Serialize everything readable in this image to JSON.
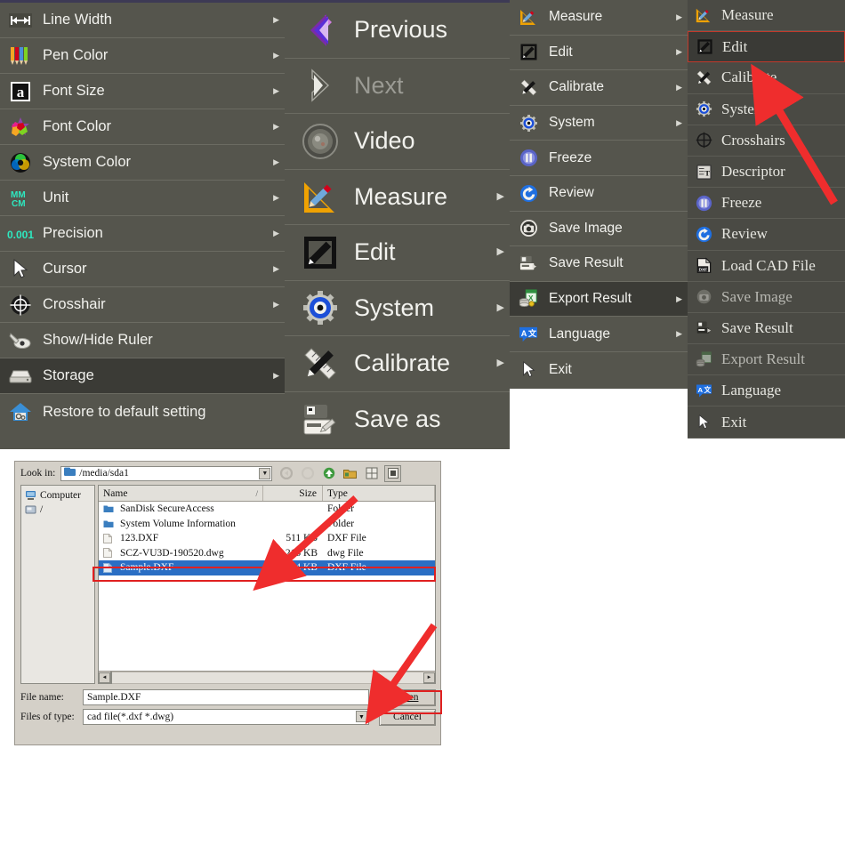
{
  "colors": {
    "menu_bg": "#55554d",
    "menu_bg_dark": "#4a4a44",
    "menu_selected": "#3b3b36",
    "menu_text": "#f2f2ee",
    "menu_text_disabled": "#9b9b94",
    "dialog_bg": "#d4d0c8",
    "selection_blue": "#2a6ec4",
    "annotation_red": "#e02020",
    "accent_purple": "#3d3a55"
  },
  "settings_menu": {
    "name": "Settings / System sub-menu",
    "items": [
      {
        "label": "Line Width",
        "icon": "line-width-icon",
        "arrow": true,
        "selected": false
      },
      {
        "label": "Pen Color",
        "icon": "pen-color-icon",
        "arrow": true,
        "selected": false
      },
      {
        "label": "Font Size",
        "icon": "font-size-icon",
        "arrow": true,
        "selected": false
      },
      {
        "label": "Font Color",
        "icon": "font-color-icon",
        "arrow": true,
        "selected": false
      },
      {
        "label": "System Color",
        "icon": "system-color-icon",
        "arrow": true,
        "selected": false
      },
      {
        "label": "Unit",
        "icon": "unit-icon",
        "arrow": true,
        "selected": false
      },
      {
        "label": "Precision",
        "icon": "precision-icon",
        "arrow": true,
        "selected": false
      },
      {
        "label": "Cursor",
        "icon": "cursor-icon",
        "arrow": true,
        "selected": false
      },
      {
        "label": "Crosshair",
        "icon": "crosshair-icon",
        "arrow": true,
        "selected": false
      },
      {
        "label": "Show/Hide Ruler",
        "icon": "ruler-toggle-icon",
        "arrow": false,
        "selected": false
      },
      {
        "label": "Storage",
        "icon": "storage-icon",
        "arrow": true,
        "selected": true
      },
      {
        "label": "Restore to default setting",
        "icon": "restore-default-icon",
        "arrow": false,
        "selected": false
      }
    ]
  },
  "main_menu": {
    "name": "Main menu (large)",
    "items": [
      {
        "label": "Previous",
        "icon": "previous-icon",
        "arrow": false,
        "disabled": false
      },
      {
        "label": "Next",
        "icon": "next-icon",
        "arrow": false,
        "disabled": true
      },
      {
        "label": "Video",
        "icon": "video-icon",
        "arrow": false,
        "disabled": false
      },
      {
        "label": "Measure",
        "icon": "measure-icon",
        "arrow": true,
        "disabled": false
      },
      {
        "label": "Edit",
        "icon": "edit-icon",
        "arrow": true,
        "disabled": false
      },
      {
        "label": "System",
        "icon": "system-icon",
        "arrow": true,
        "disabled": false
      },
      {
        "label": "Calibrate",
        "icon": "calibrate-icon",
        "arrow": true,
        "disabled": false
      },
      {
        "label": "Save as",
        "icon": "save-as-icon",
        "arrow": false,
        "disabled": false
      }
    ]
  },
  "compact_menu": {
    "name": "Compact menu",
    "items": [
      {
        "label": "Measure",
        "icon": "measure-icon",
        "arrow": true,
        "selected": false
      },
      {
        "label": "Edit",
        "icon": "edit-icon",
        "arrow": true,
        "selected": false
      },
      {
        "label": "Calibrate",
        "icon": "calibrate-icon",
        "arrow": true,
        "selected": false
      },
      {
        "label": "System",
        "icon": "system-icon",
        "arrow": true,
        "selected": false
      },
      {
        "label": "Freeze",
        "icon": "freeze-icon",
        "arrow": false,
        "selected": false
      },
      {
        "label": "Review",
        "icon": "review-icon",
        "arrow": false,
        "selected": false
      },
      {
        "label": "Save Image",
        "icon": "save-image-icon",
        "arrow": false,
        "selected": false
      },
      {
        "label": "Save Result",
        "icon": "save-result-icon",
        "arrow": false,
        "selected": false
      },
      {
        "label": "Export Result",
        "icon": "export-result-icon",
        "arrow": true,
        "selected": true
      },
      {
        "label": "Language",
        "icon": "language-icon",
        "arrow": true,
        "selected": false
      },
      {
        "label": "Exit",
        "icon": "exit-icon",
        "arrow": false,
        "selected": false
      }
    ]
  },
  "extended_menu": {
    "name": "Extended menu with Load CAD File",
    "items": [
      {
        "label": "Measure",
        "icon": "measure-icon",
        "boxed": false,
        "dim": false
      },
      {
        "label": "Edit",
        "icon": "edit-icon",
        "boxed": true,
        "dim": false
      },
      {
        "label": "Calibrate",
        "icon": "calibrate-icon",
        "boxed": false,
        "dim": false
      },
      {
        "label": "System",
        "icon": "system-icon",
        "boxed": false,
        "dim": false
      },
      {
        "label": "Crosshairs",
        "icon": "crosshair-icon",
        "boxed": false,
        "dim": false
      },
      {
        "label": "Descriptor",
        "icon": "descriptor-icon",
        "boxed": false,
        "dim": false
      },
      {
        "label": "Freeze",
        "icon": "freeze-icon",
        "boxed": false,
        "dim": false
      },
      {
        "label": "Review",
        "icon": "review-icon",
        "boxed": false,
        "dim": false
      },
      {
        "label": "Load CAD File",
        "icon": "load-cad-file-icon",
        "boxed": false,
        "dim": false
      },
      {
        "label": "Save Image",
        "icon": "save-image-icon",
        "boxed": false,
        "dim": true
      },
      {
        "label": "Save Result",
        "icon": "save-result-icon",
        "boxed": false,
        "dim": false
      },
      {
        "label": "Export Result",
        "icon": "export-result-icon",
        "boxed": false,
        "dim": true
      },
      {
        "label": "Language",
        "icon": "language-icon",
        "boxed": false,
        "dim": false
      },
      {
        "label": "Exit",
        "icon": "exit-icon",
        "boxed": false,
        "dim": false
      }
    ]
  },
  "file_dialog": {
    "look_in_label": "Look in:",
    "look_in_value": "/media/sda1",
    "toolbar": [
      {
        "name": "back-button",
        "glyph": "◄"
      },
      {
        "name": "forward-button",
        "glyph": "►"
      },
      {
        "name": "parent-directory-button",
        "glyph": "▲"
      },
      {
        "name": "new-folder-button",
        "glyph": "▣"
      },
      {
        "name": "list-view-button",
        "glyph": "▤"
      },
      {
        "name": "detail-view-button",
        "glyph": "▦"
      }
    ],
    "sidebar": [
      {
        "label": "Computer",
        "icon": "computer-icon"
      },
      {
        "label": "/",
        "icon": "drive-icon"
      }
    ],
    "columns": [
      "Name",
      "Size",
      "Type"
    ],
    "files": [
      {
        "name": "SanDisk SecureAccess",
        "size": "",
        "type": "Folder",
        "icon": "folder-icon",
        "selected": false
      },
      {
        "name": "System Volume Information",
        "size": "",
        "type": "Folder",
        "icon": "folder-icon",
        "selected": false
      },
      {
        "name": "123.DXF",
        "size": "511 KB",
        "type": "DXF File",
        "icon": "file-icon",
        "selected": false
      },
      {
        "name": "SCZ-VU3D-190520.dwg",
        "size": "213 KB",
        "type": "dwg File",
        "icon": "file-icon",
        "selected": false
      },
      {
        "name": "Sample.DXF",
        "size": "204 KB",
        "type": "DXF File",
        "icon": "file-icon",
        "selected": true
      }
    ],
    "file_name_label": "File name:",
    "file_name_value": "Sample.DXF",
    "files_of_type_label": "Files of type:",
    "files_of_type_value": "cad file(*.dxf *.dwg)",
    "open_button": "Open",
    "cancel_button": "Cancel"
  }
}
